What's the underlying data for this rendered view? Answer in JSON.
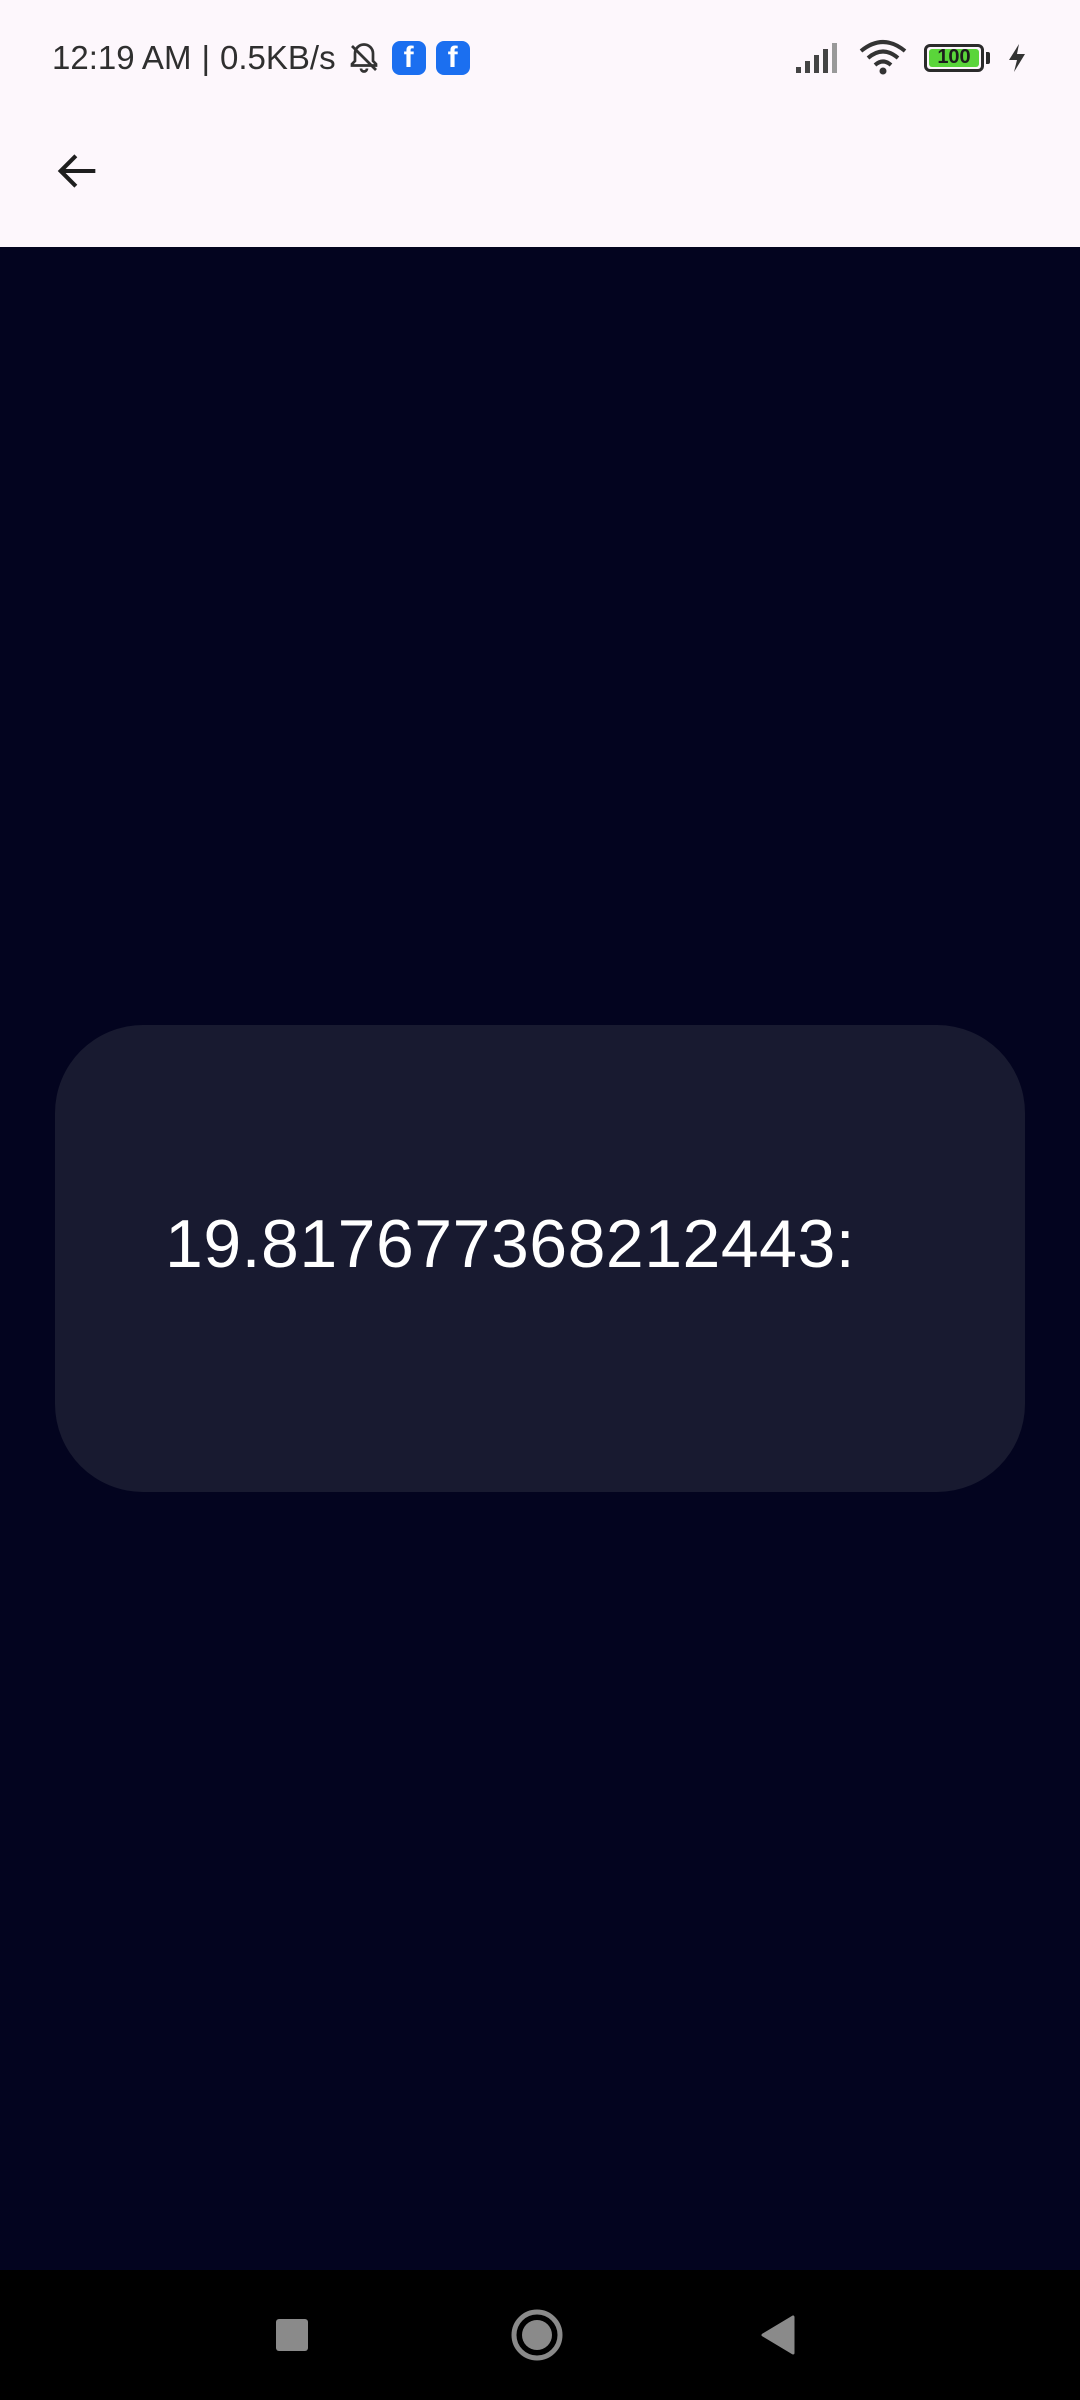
{
  "status_bar": {
    "time": "12:19 AM",
    "separator": "|",
    "net_speed": "0.5KB/s",
    "battery_level": "100",
    "icons": [
      "bell-off-icon",
      "facebook-icon",
      "facebook-icon",
      "signal-icon",
      "wifi-icon",
      "battery-icon",
      "charging-icon"
    ]
  },
  "app_bar": {
    "back_icon": "arrow-left-icon"
  },
  "card": {
    "text": "19.817677368212443:"
  },
  "nav_bar": {
    "icons": [
      "square-recent-icon",
      "circle-home-icon",
      "triangle-back-icon"
    ]
  },
  "colors": {
    "background": "#03041f",
    "card": "#181a30",
    "status_bar": "#fdf7fc",
    "nav_bar": "#000000",
    "facebook": "#1b6ff0",
    "battery_fill": "#5ad53a"
  }
}
